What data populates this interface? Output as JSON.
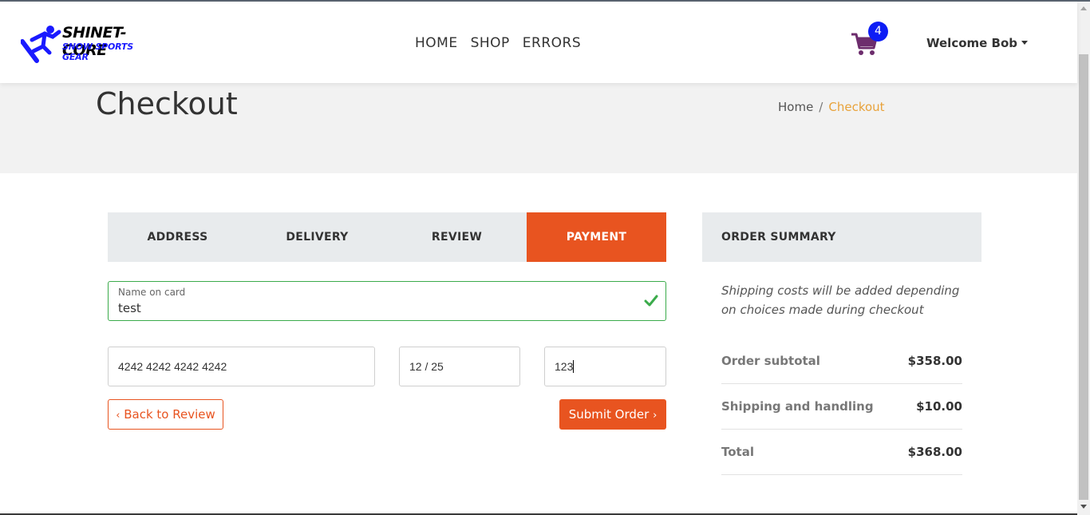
{
  "brand": {
    "name": "SHINET-CORE",
    "tagline": "SNOW SPORTS GEAR"
  },
  "nav": {
    "home": "HOME",
    "shop": "SHOP",
    "errors": "ERRORS"
  },
  "cart": {
    "count": "4"
  },
  "user": {
    "welcome": "Welcome Bob"
  },
  "page": {
    "title": "Checkout"
  },
  "breadcrumb": {
    "home": "Home",
    "separator": "/",
    "current": "Checkout"
  },
  "tabs": [
    {
      "label": "ADDRESS"
    },
    {
      "label": "DELIVERY"
    },
    {
      "label": "REVIEW"
    },
    {
      "label": "PAYMENT"
    }
  ],
  "payment": {
    "name_label": "Name on card",
    "name_value": "test",
    "card_number": "4242 4242 4242 4242",
    "expiry": "12 / 25",
    "cvc": "123"
  },
  "buttons": {
    "back": "Back to Review",
    "submit": "Submit Order"
  },
  "summary": {
    "heading": "ORDER SUMMARY",
    "note": "Shipping costs will be added depending on choices made during checkout",
    "rows": [
      {
        "label": "Order subtotal",
        "value": "$358.00"
      },
      {
        "label": "Shipping and handling",
        "value": "$10.00"
      },
      {
        "label": "Total",
        "value": "$368.00"
      }
    ]
  },
  "colors": {
    "accent": "#e85420",
    "badge": "#0d1df5",
    "breadcrumb_active": "#e8a23a",
    "valid": "#3bab4b"
  }
}
